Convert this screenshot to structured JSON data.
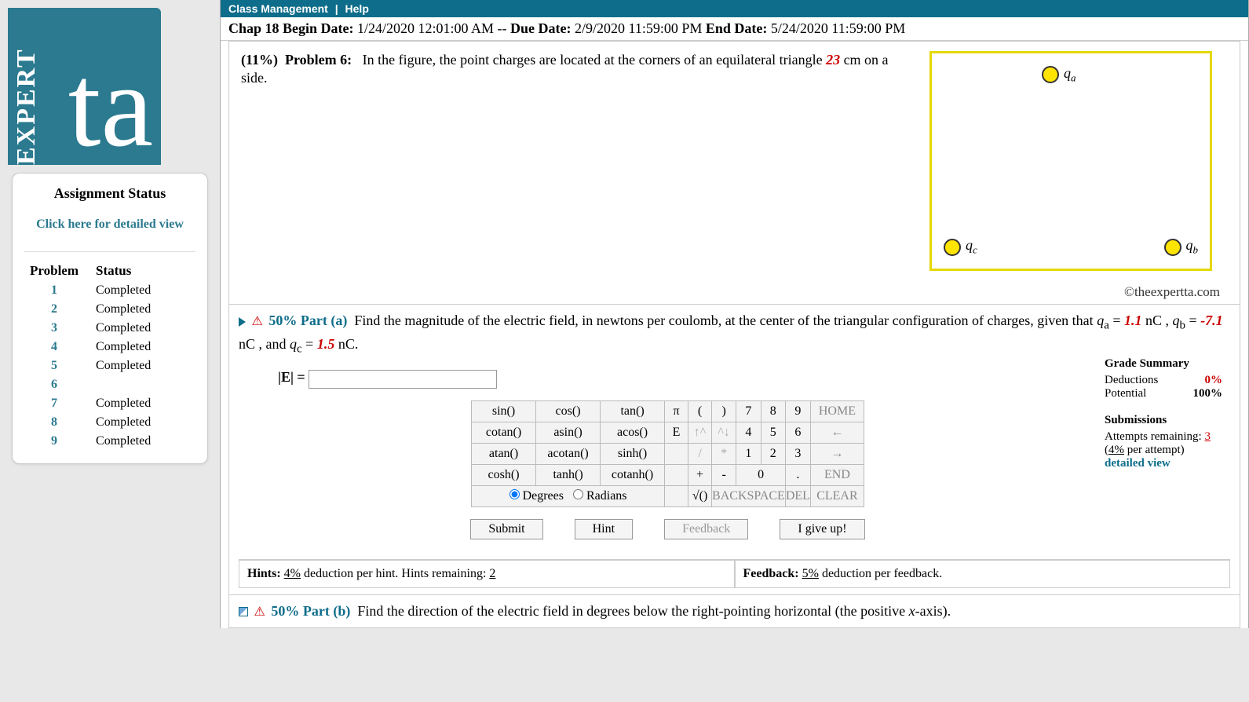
{
  "sidebar": {
    "logo_vert": "EXPERT",
    "logo_ta": "ta",
    "status_title": "Assignment Status",
    "detailed_link": "Click here for detailed view",
    "ps_header_prob": "Problem",
    "ps_header_stat": "Status",
    "problems": [
      {
        "n": "1",
        "s": "Completed"
      },
      {
        "n": "2",
        "s": "Completed"
      },
      {
        "n": "3",
        "s": "Completed"
      },
      {
        "n": "4",
        "s": "Completed"
      },
      {
        "n": "5",
        "s": "Completed"
      },
      {
        "n": "6",
        "s": ""
      },
      {
        "n": "7",
        "s": "Completed"
      },
      {
        "n": "8",
        "s": "Completed"
      },
      {
        "n": "9",
        "s": "Completed"
      }
    ]
  },
  "topbar": {
    "item1": "Class Management",
    "sep": "|",
    "item2": "Help"
  },
  "dates": {
    "chap": "Chap 18",
    "begin_lbl": "Begin Date:",
    "begin": "1/24/2020 12:01:00 AM",
    "sep": " -- ",
    "due_lbl": "Due Date:",
    "due": "2/9/2020 11:59:00 PM",
    "end_lbl": "End Date:",
    "end": "5/24/2020 11:59:00 PM"
  },
  "problem": {
    "pct": "(11%)",
    "label": "Problem 6:",
    "text1": "In the figure, the point charges are located at the corners of an equilateral triangle ",
    "val": "23",
    "text2": " cm on a side."
  },
  "charges": {
    "qa": "qₐ",
    "qb": "q_b",
    "qc": "q_c"
  },
  "copyright": "©theexpertta.com",
  "parta": {
    "pct": "50% Part (a)",
    "text1": "Find the magnitude of the electric field, in newtons per coulomb, at the center of the triangular configuration of charges, given that ",
    "qa": "qₐ",
    "eq": " = ",
    "v1": "1.1",
    "u": " nC , ",
    "qb": "q_b",
    "v2": "-7.1",
    "u2": " nC , and ",
    "qc": "q_c",
    "v3": "1.5",
    "u3": " nC.",
    "answer_label": "|E| ="
  },
  "grade": {
    "title": "Grade Summary",
    "ded_lbl": "Deductions",
    "ded": "0%",
    "pot_lbl": "Potential",
    "pot": "100%",
    "sub_title": "Submissions",
    "att_lbl": "Attempts remaining: ",
    "att": "3",
    "pct_lbl": "(",
    "pct": "4%",
    "pct_lbl2": " per attempt)",
    "detail": "detailed view"
  },
  "keypad": {
    "r1": [
      "sin()",
      "cos()",
      "tan()",
      "π",
      "(",
      ")",
      "7",
      "8",
      "9",
      "HOME"
    ],
    "r2": [
      "cotan()",
      "asin()",
      "acos()",
      "E",
      "↑^",
      "^↓",
      "4",
      "5",
      "6",
      "←"
    ],
    "r3": [
      "atan()",
      "acotan()",
      "sinh()",
      "/",
      "*",
      "1",
      "2",
      "3",
      "→"
    ],
    "r4": [
      "cosh()",
      "tanh()",
      "cotanh()",
      "+",
      "-",
      "0",
      ".",
      "END"
    ],
    "r5": [
      "Degrees",
      "Radians",
      "√()",
      "BACKSPACE",
      "DEL",
      "CLEAR"
    ]
  },
  "actions": {
    "submit": "Submit",
    "hint": "Hint",
    "feedback": "Feedback",
    "giveup": "I give up!"
  },
  "hints": {
    "h_lbl": "Hints:",
    "h_pct": "4%",
    "h_txt": " deduction per hint. Hints remaining: ",
    "h_rem": "2",
    "f_lbl": "Feedback:",
    "f_pct": "5%",
    "f_txt": " deduction per feedback."
  },
  "partb": {
    "pct": "50% Part (b)",
    "text": "Find the direction of the electric field in degrees below the right-pointing horizontal (the positive ",
    "x": "x",
    "text2": "-axis)."
  }
}
